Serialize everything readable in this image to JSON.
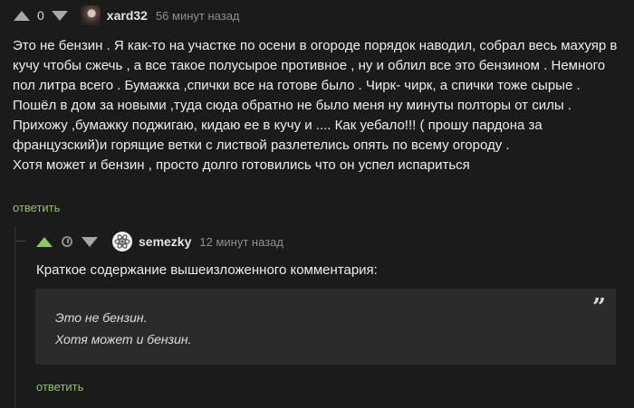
{
  "comment1": {
    "score": "0",
    "author": "xard32",
    "time": "56 минут назад",
    "lines": [
      "Это не бензин . Я как-то на участке по осени в огороде порядок наводил, собрал весь махуяр в",
      "кучу чтобы сжечь , а все такое полусырое противное , ну и облил все это бензином . Немного",
      "пол литра всего . Бумажка ,спички все на готове было . Чирк- чирк, а спички тоже сырые .",
      "Пошёл в дом за новыми ,туда сюда обратно не было меня ну минуты полторы от силы .",
      "Прихожу ,бумажку поджигаю, кидаю ее в кучу и .... Как уебало!!! ( прошу пардона за",
      "французский)и горящие ветки с листвой разлетелись опять по всему огороду .",
      "Хотя может и бензин , просто долго готовились что он успел испариться"
    ],
    "reply_label": "ответить",
    "avatar_icon": "user-avatar-icon"
  },
  "comment2": {
    "author": "semezky",
    "time": "12 минут назад",
    "intro": "Краткое содержание вышеизложенного комментария:",
    "quote_lines": [
      "Это не бензин.",
      "Хотя может и бензин."
    ],
    "quote_mark": "”",
    "reply_label": "ответить",
    "avatar_icon": "atom-avatar-icon"
  },
  "colors": {
    "background": "#1b1b1c",
    "accent_green": "#8ac858",
    "quote_bg": "#2b2b2c"
  }
}
